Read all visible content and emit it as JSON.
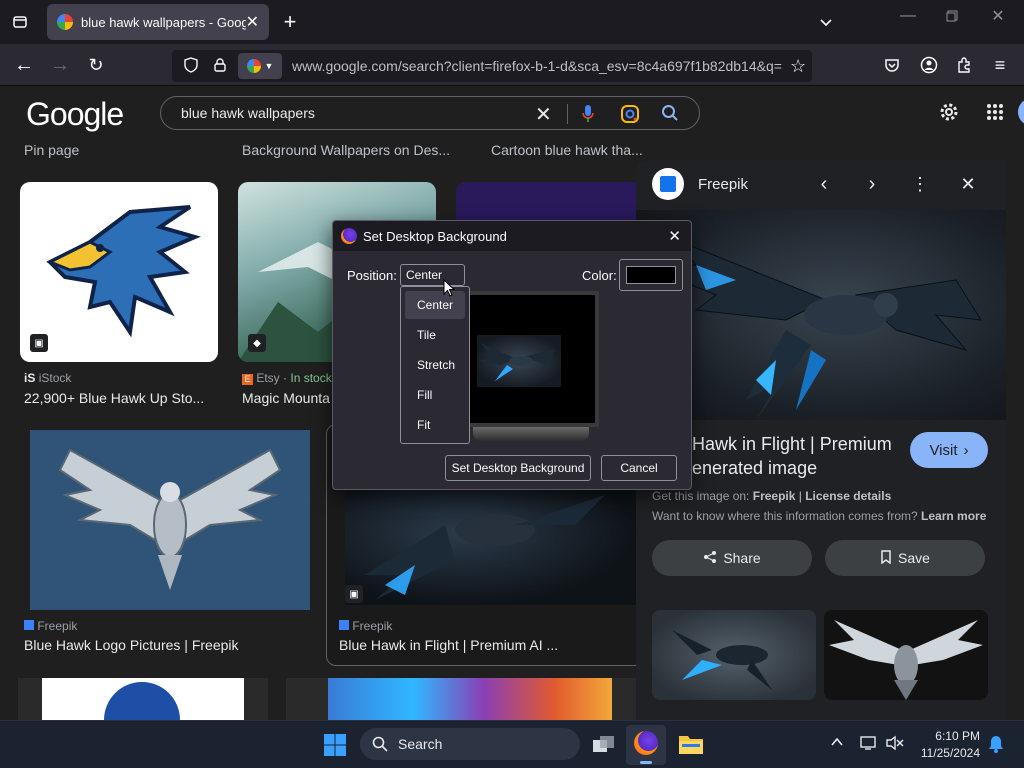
{
  "browser": {
    "tab_title": "blue hawk wallpapers - Google",
    "url": "www.google.com/search?client=firefox-b-1-d&sca_esv=8c4a697f1b82db14&q="
  },
  "google": {
    "logo": "Google",
    "query": "blue hawk wallpapers"
  },
  "results": {
    "top_captions": [
      "Pin page",
      "Background Wallpapers on Des...",
      "Cartoon blue hawk tha..."
    ],
    "row1": [
      {
        "source": "iStock",
        "title": "22,900+ Blue Hawk Up Sto..."
      },
      {
        "source": "Etsy",
        "source_extra": "· In stock",
        "title": "Magic Mounta"
      }
    ],
    "row2": [
      {
        "source": "Freepik",
        "title": "Blue Hawk Logo Pictures | Freepik"
      },
      {
        "source": "Freepik",
        "title": "Blue Hawk in Flight | Premium AI ..."
      }
    ]
  },
  "panel": {
    "source_name": "Freepik",
    "title": "Hawk in Flight | Premium",
    "title_line2": "enerated image",
    "visit_label": "Visit",
    "get_image_prefix": "Get this image on:",
    "get_image_source": "Freepik",
    "license": "License details",
    "info_prefix": "Want to know where this information comes from?",
    "learn_more": "Learn more",
    "share_label": "Share",
    "save_label": "Save"
  },
  "dialog": {
    "title": "Set Desktop Background",
    "position_label": "Position:",
    "position_value": "Center",
    "color_label": "Color:",
    "color_value": "#000000",
    "options": [
      "Center",
      "Tile",
      "Stretch",
      "Fill",
      "Fit"
    ],
    "set_button": "Set Desktop Background",
    "cancel_button": "Cancel"
  },
  "taskbar": {
    "search_label": "Search",
    "time": "6:10 PM",
    "date": "11/25/2024"
  },
  "colors": {
    "accent_blue": "#8ab4f8",
    "visit_bg": "#8ab4f8",
    "hawk_blue": "#2c6fb7"
  }
}
